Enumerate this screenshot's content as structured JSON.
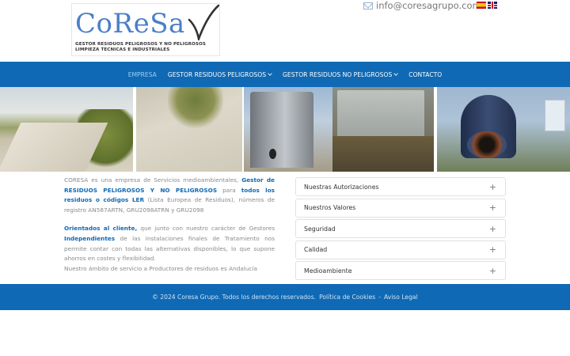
{
  "header": {
    "logo_word": "CoReSa",
    "logo_tagline_1": "GESTOR RESIDUOS PELIGROSOS Y NO PELIGROSOS",
    "logo_tagline_2": "LIMPIEZA TECNICAS E INDUSTRIALES",
    "email": "info@coresagrupo.com",
    "icons": [
      "mail-icon",
      "flag-es-icon",
      "flag-en-icon"
    ]
  },
  "nav": {
    "items": [
      {
        "label": "EMPRESA",
        "active": true
      },
      {
        "label": "GESTOR RESIDUOS PELIGROSOS",
        "dropdown": true
      },
      {
        "label": "GESTOR RESIDUOS NO PELIGROSOS",
        "dropdown": true
      },
      {
        "label": "CONTACTO"
      }
    ]
  },
  "content": {
    "p1_a": "CORESA es una empresa de Servicios medioambientales, ",
    "p1_b": "Gestor de RESIDUOS PELIGROSOS Y NO PELIGROSOS",
    "p1_c": " para ",
    "p1_d": "todos los residuos o códigos LER",
    "p1_e": " (Lista Europea de Residuos), números de registro AN587ARTN, GRU2098ATRN y GRU2098",
    "p2_a": "Orientados al cliente,",
    "p2_b": " que junto con nuestro carácter de Gestores ",
    "p2_c": "Independientes",
    "p2_d": " de las instalaciones finales de Tratamiento nos permite contar con todas las alternativas disponibles, lo que supone ahorros en costes y flexibilidad.",
    "p3": "Nuestro ámbito de servicio a Productores de residuos es Andalucía"
  },
  "accordion": {
    "items": [
      {
        "label": "Nuestras Autorizaciones"
      },
      {
        "label": "Nuestros Valores"
      },
      {
        "label": "Seguridad"
      },
      {
        "label": "Calidad"
      },
      {
        "label": "Medioambiente"
      }
    ],
    "toggle": "+"
  },
  "footer": {
    "copyright": "© 2024 Coresa Grupo. Todos los derechos reservados.",
    "cookies": "Política de Cookies",
    "separator": "-",
    "legal": "Aviso Legal"
  },
  "colors": {
    "brand_blue": "#0f69b4",
    "nav_active": "#9fd0f5",
    "text_gray": "#8a8a8a"
  }
}
